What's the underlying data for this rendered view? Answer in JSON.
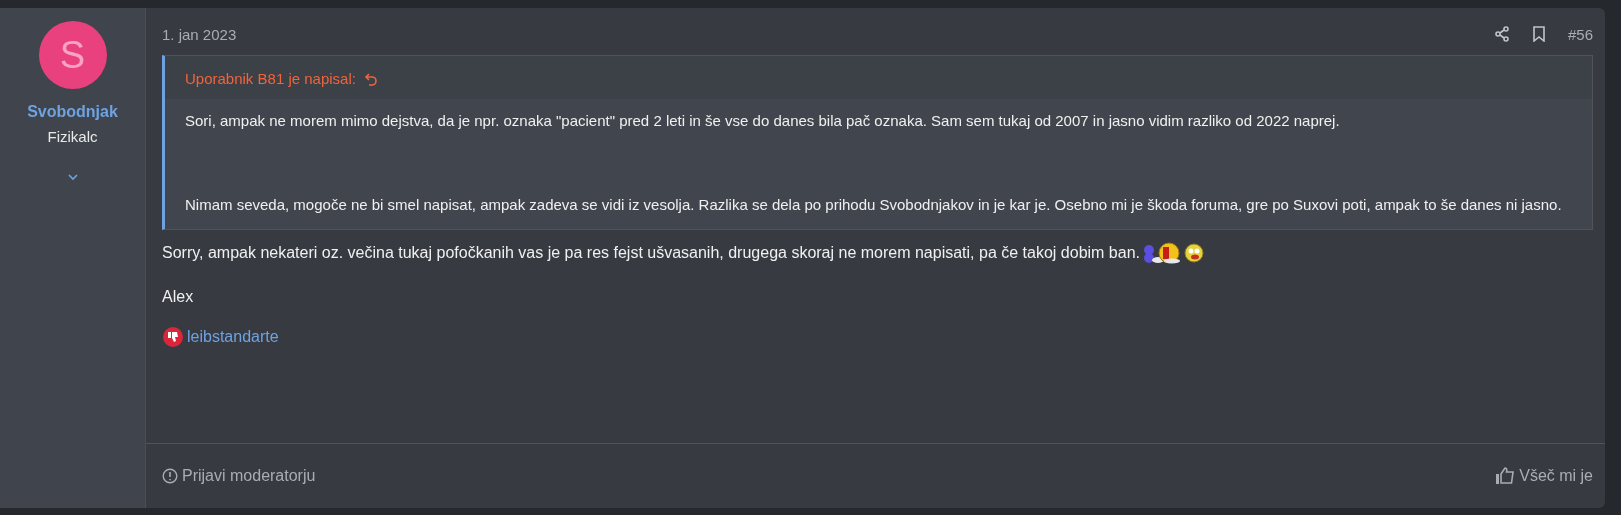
{
  "author": {
    "initial": "S",
    "name": "Svobodnjak",
    "title": "Fizikalc"
  },
  "post": {
    "date": "1. jan 2023",
    "number": "#56"
  },
  "quote": {
    "header": "Uporabnik B81 je napisal:",
    "paragraphs": [
      "Sori, ampak ne morem mimo dejstva, da je npr. oznaka \"pacient\" pred 2 leti in še vse do danes bila pač oznaka. Sam sem tukaj od 2007 in jasno vidim razliko od 2022 naprej.",
      "Nimam seveda, mogoče ne bi smel napisat, ampak zadeva se vidi iz vesolja. Razlika se dela po prihodu Svobodnjakov in je kar je. Osebno mi je škoda foruma, gre po Suxovi poti, ampak to še danes ni jasno."
    ]
  },
  "body": [
    "Sorry, ampak nekateri oz. večina tukaj pofočkanih vas je pa res fejst ušvasanih, drugega skoraj ne morem napisati, pa če takoj dobim ban.",
    "Alex"
  ],
  "reactions": [
    {
      "user": "leibstandarte"
    }
  ],
  "footer": {
    "report": "Prijavi moderatorju",
    "like": "Všeč mi je"
  }
}
